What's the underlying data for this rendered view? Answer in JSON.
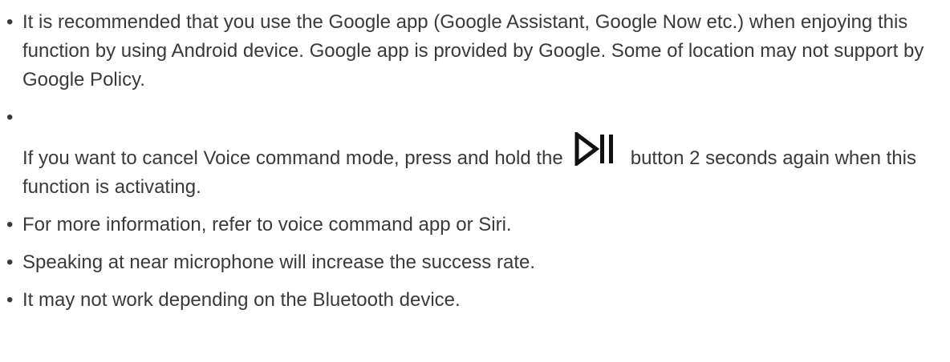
{
  "bullet": "•",
  "notes": [
    {
      "text": "It is recommended that you use the Google app (Google Assistant, Google Now etc.) when enjoying this function by using Android device. Google app is provided by Google. Some of location may not support by Google Policy."
    },
    {
      "text_before": "If you want to cancel Voice command mode, press and hold the",
      "icon": "play-pause-icon",
      "text_after": "button 2 seconds again when this function is activating."
    },
    {
      "text": "For more information, refer to voice command app or Siri."
    },
    {
      "text": "Speaking at near microphone will increase the success rate."
    },
    {
      "text": "It may not work depending on the Bluetooth device."
    }
  ],
  "colors": {
    "text": "#3a3a3a",
    "icon": "#111111",
    "background": "#ffffff"
  }
}
